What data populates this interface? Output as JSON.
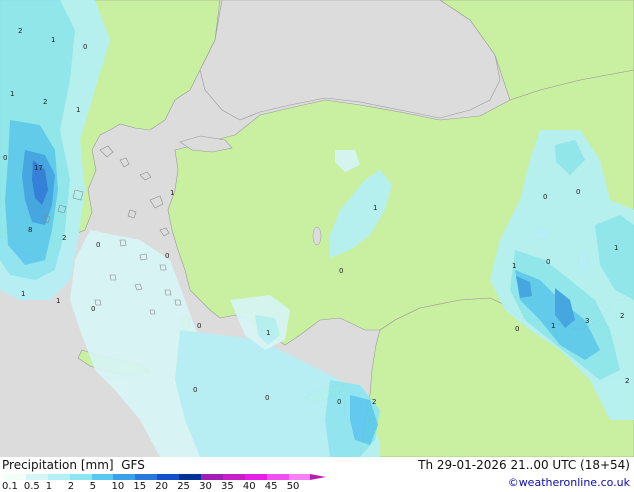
{
  "legend": {
    "title": "Precipitation [mm]",
    "model": "GFS",
    "scale_labels": [
      "0.1",
      "0.5",
      "1",
      "2",
      "5",
      "10",
      "15",
      "20",
      "25",
      "30",
      "35",
      "40",
      "45",
      "50"
    ],
    "scale_colors": [
      "#f5fffa",
      "#d7f5f5",
      "#b4f0f5",
      "#8ce6f0",
      "#5ac8f0",
      "#3ca0e6",
      "#2878dc",
      "#1450c8",
      "#003296",
      "#a01eb4",
      "#c81ec8",
      "#e61ee6",
      "#f050f0",
      "#f582f5"
    ]
  },
  "datetime": "Th 29-01-2026 21..00 UTC (18+54)",
  "credit": "©weatheronline.co.uk",
  "map": {
    "land_color": "#c8f0a0",
    "outside_color": "#dcdcdc",
    "sea_color": "#dcdcdc",
    "precip_labels": [
      "2",
      "1",
      "0",
      "1",
      "2",
      "1",
      "0",
      "17",
      "8",
      "2",
      "1",
      "0",
      "1",
      "1",
      "0",
      "0",
      "0",
      "1",
      "0",
      "0",
      "0",
      "2",
      "0",
      "0",
      "1",
      "0",
      "1",
      "0",
      "3",
      "2",
      "1",
      "2",
      "0",
      "1"
    ]
  }
}
